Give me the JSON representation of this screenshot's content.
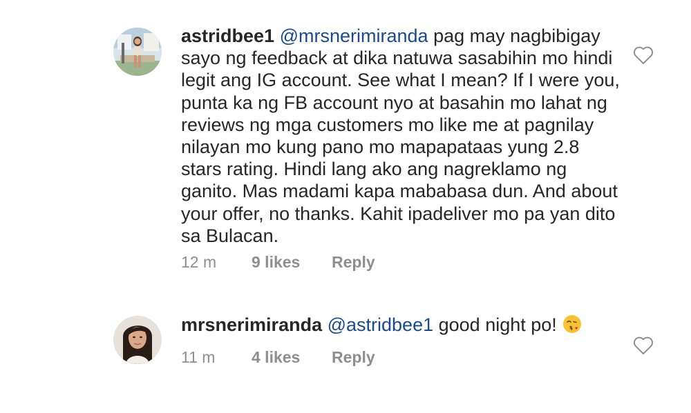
{
  "comments": [
    {
      "username": "astridbee1",
      "mention": "@mrsnerimiranda",
      "text": "pag may nagbibigay sayo ng feedback at dika natuwa sasabihin mo hindi legit ang IG account. See what I mean? If I were you, punta ka ng FB account nyo at basahin mo lahat ng reviews ng mga customers mo like me at pagnilay nilayan mo kung pano mo mapapataas yung 2.8 stars rating. Hindi lang ako ang nagreklamo ng ganito. Mas madami kapa mababasa dun. And about your offer, no thanks. Kahit ipadeliver mo pa yan dito sa Bulacan.",
      "time": "12 m",
      "likes": "9 likes",
      "reply": "Reply",
      "avatar_icon": "profile-photo-woman-standing-outdoors",
      "like_icon": "heart-outline-icon"
    },
    {
      "username": "mrsnerimiranda",
      "mention": "@astridbee1",
      "text": "good night po!",
      "emoji": "face-blowing-kiss-emoji",
      "time": "11 m",
      "likes": "4 likes",
      "reply": "Reply",
      "avatar_icon": "profile-photo-woman-portrait",
      "like_icon": "heart-outline-icon"
    }
  ],
  "colors": {
    "text": "#262626",
    "mention": "#1a4a8a",
    "meta": "#8e8e8e",
    "heart": "#8e8e8e"
  }
}
